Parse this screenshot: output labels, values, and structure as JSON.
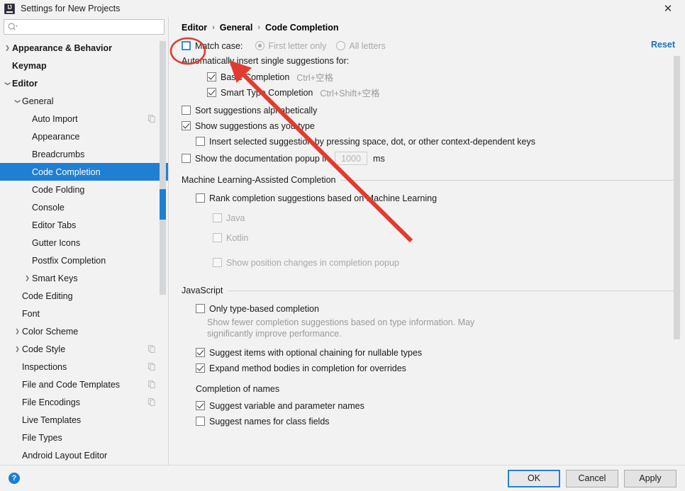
{
  "window": {
    "title": "Settings for New Projects",
    "logo_text": "IJ",
    "close_label": "✕"
  },
  "search": {
    "placeholder": "",
    "value": "",
    "icon": "search-icon"
  },
  "sidebar": {
    "items": [
      {
        "label": "Appearance & Behavior",
        "arrow": "collapsed",
        "depth": 0,
        "bold": true,
        "selected": false,
        "badge": false
      },
      {
        "label": "Keymap",
        "arrow": "none",
        "depth": 0,
        "bold": true,
        "selected": false,
        "badge": false
      },
      {
        "label": "Editor",
        "arrow": "expanded",
        "depth": 0,
        "bold": true,
        "selected": false,
        "badge": false
      },
      {
        "label": "General",
        "arrow": "expanded",
        "depth": 1,
        "bold": false,
        "selected": false,
        "badge": false
      },
      {
        "label": "Auto Import",
        "arrow": "none",
        "depth": 2,
        "bold": false,
        "selected": false,
        "badge": true
      },
      {
        "label": "Appearance",
        "arrow": "none",
        "depth": 2,
        "bold": false,
        "selected": false,
        "badge": false
      },
      {
        "label": "Breadcrumbs",
        "arrow": "none",
        "depth": 2,
        "bold": false,
        "selected": false,
        "badge": false
      },
      {
        "label": "Code Completion",
        "arrow": "none",
        "depth": 2,
        "bold": false,
        "selected": true,
        "badge": false
      },
      {
        "label": "Code Folding",
        "arrow": "none",
        "depth": 2,
        "bold": false,
        "selected": false,
        "badge": false
      },
      {
        "label": "Console",
        "arrow": "none",
        "depth": 2,
        "bold": false,
        "selected": false,
        "badge": false
      },
      {
        "label": "Editor Tabs",
        "arrow": "none",
        "depth": 2,
        "bold": false,
        "selected": false,
        "badge": false
      },
      {
        "label": "Gutter Icons",
        "arrow": "none",
        "depth": 2,
        "bold": false,
        "selected": false,
        "badge": false
      },
      {
        "label": "Postfix Completion",
        "arrow": "none",
        "depth": 2,
        "bold": false,
        "selected": false,
        "badge": false
      },
      {
        "label": "Smart Keys",
        "arrow": "collapsed",
        "depth": 2,
        "bold": false,
        "selected": false,
        "badge": false
      },
      {
        "label": "Code Editing",
        "arrow": "none",
        "depth": 1,
        "bold": false,
        "selected": false,
        "badge": false
      },
      {
        "label": "Font",
        "arrow": "none",
        "depth": 1,
        "bold": false,
        "selected": false,
        "badge": false
      },
      {
        "label": "Color Scheme",
        "arrow": "collapsed",
        "depth": 1,
        "bold": false,
        "selected": false,
        "badge": false
      },
      {
        "label": "Code Style",
        "arrow": "collapsed",
        "depth": 1,
        "bold": false,
        "selected": false,
        "badge": true
      },
      {
        "label": "Inspections",
        "arrow": "none",
        "depth": 1,
        "bold": false,
        "selected": false,
        "badge": true
      },
      {
        "label": "File and Code Templates",
        "arrow": "none",
        "depth": 1,
        "bold": false,
        "selected": false,
        "badge": true
      },
      {
        "label": "File Encodings",
        "arrow": "none",
        "depth": 1,
        "bold": false,
        "selected": false,
        "badge": true
      },
      {
        "label": "Live Templates",
        "arrow": "none",
        "depth": 1,
        "bold": false,
        "selected": false,
        "badge": false
      },
      {
        "label": "File Types",
        "arrow": "none",
        "depth": 1,
        "bold": false,
        "selected": false,
        "badge": false
      },
      {
        "label": "Android Layout Editor",
        "arrow": "none",
        "depth": 1,
        "bold": false,
        "selected": false,
        "badge": false
      }
    ]
  },
  "main": {
    "breadcrumb": [
      "Editor",
      "General",
      "Code Completion"
    ],
    "breadcrumb_separator": "›",
    "reset_label": "Reset",
    "match_case": {
      "label": "Match case:",
      "checked": false,
      "focused": true,
      "options": [
        {
          "label": "First letter only",
          "selected": true,
          "disabled": true
        },
        {
          "label": "All letters",
          "selected": false,
          "disabled": true
        }
      ]
    },
    "auto_insert_header": "Automatically insert single suggestions for:",
    "auto_insert_items": [
      {
        "label": "Basic Completion",
        "checked": true,
        "shortcut": "Ctrl+空格"
      },
      {
        "label": "Smart Type Completion",
        "checked": true,
        "shortcut": "Ctrl+Shift+空格"
      }
    ],
    "sort_alphabetically": {
      "label": "Sort suggestions alphabetically",
      "checked": false
    },
    "show_as_you_type": {
      "label": "Show suggestions as you type",
      "checked": true
    },
    "insert_by_keys": {
      "label": "Insert selected suggestion by pressing space, dot, or other context-dependent keys",
      "checked": false
    },
    "doc_popup": {
      "label_before": "Show the documentation popup in",
      "value": "1000",
      "label_after": "ms",
      "checked": false
    },
    "ml_section": {
      "title": "Machine Learning-Assisted Completion",
      "rank": {
        "label": "Rank completion suggestions based on Machine Learning",
        "checked": false
      },
      "languages": [
        {
          "label": "Java",
          "checked": false,
          "disabled": true
        },
        {
          "label": "Kotlin",
          "checked": false,
          "disabled": true
        }
      ],
      "position_changes": {
        "label": "Show position changes in completion popup",
        "checked": false,
        "disabled": true
      }
    },
    "js_section": {
      "title": "JavaScript",
      "only_type_based": {
        "label": "Only type-based completion",
        "checked": false,
        "mnemonic": "c"
      },
      "only_type_based_desc": "Show fewer completion suggestions based on type information. May significantly improve performance.",
      "optional_chaining": {
        "label": "Suggest items with optional chaining for nullable types",
        "checked": true,
        "mnemonic": "o"
      },
      "expand_bodies": {
        "label": "Expand method bodies in completion for overrides",
        "checked": true
      }
    },
    "names_section": {
      "title": "Completion of names",
      "items": [
        {
          "label": "Suggest variable and parameter names",
          "checked": true,
          "mnemonic": "v"
        },
        {
          "label": "Suggest names for class fields",
          "checked": false,
          "mnemonic": "f"
        }
      ]
    }
  },
  "footer": {
    "help_label": "?",
    "buttons": [
      {
        "label": "OK",
        "default": true
      },
      {
        "label": "Cancel",
        "default": false
      },
      {
        "label": "Apply",
        "default": false
      }
    ]
  },
  "annotations": {
    "ellipse_color": "#e23b2e",
    "arrow_color": "#e23b2e"
  }
}
